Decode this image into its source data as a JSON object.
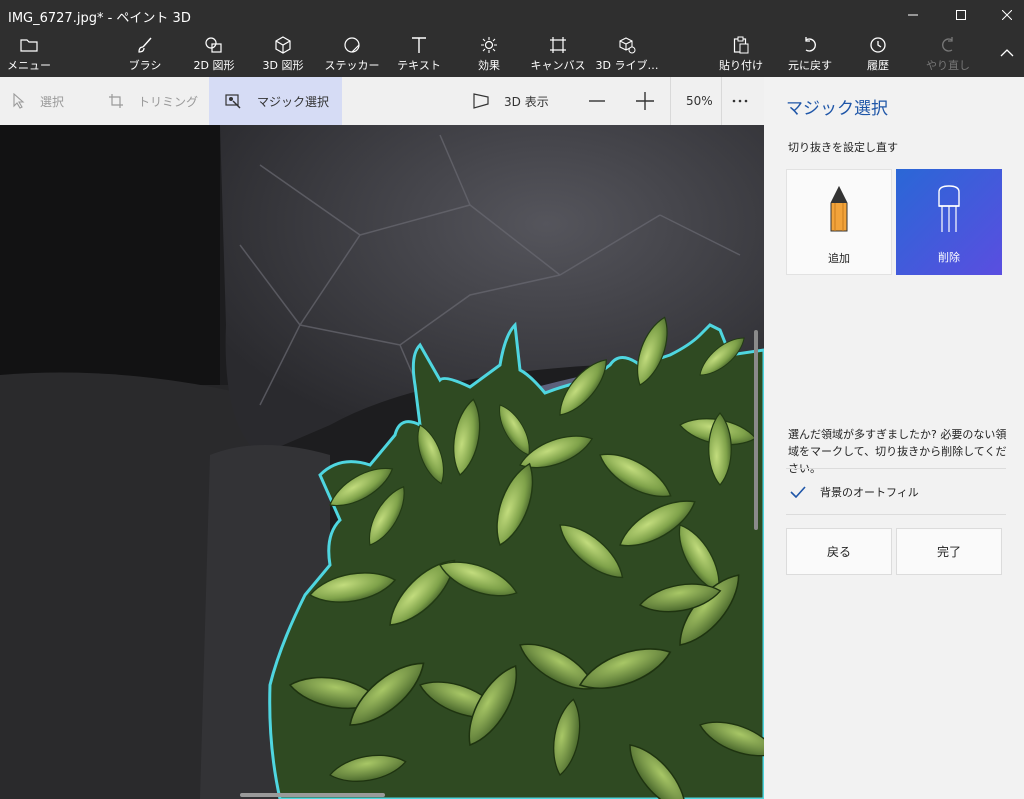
{
  "window": {
    "title": "IMG_6727.jpg* - ペイント 3D",
    "minimize_icon": "minimize-icon",
    "maximize_icon": "maximize-icon",
    "close_icon": "close-icon"
  },
  "ribbon": {
    "menu": "メニュー",
    "brush": "ブラシ",
    "shapes2d": "2D 図形",
    "shapes3d": "3D 図形",
    "stickers": "ステッカー",
    "text": "テキスト",
    "effects": "効果",
    "canvas": "キャンバス",
    "library3d": "3D ライブ…",
    "paste": "貼り付け",
    "undo": "元に戻す",
    "history": "履歴",
    "redo": "やり直し"
  },
  "subbar": {
    "select": "選択",
    "crop": "トリミング",
    "magic_select": "マジック選択",
    "view3d": "3D 表示",
    "zoom": "50%"
  },
  "panel": {
    "title": "マジック選択",
    "subtitle": "切り抜きを設定し直す",
    "add_label": "追加",
    "remove_label": "削除",
    "description": "選んだ領域が多すぎましたか? 必要のない領域をマークして、切り抜きから削除してください。",
    "autofill_label": "背景のオートフィル",
    "autofill_checked": true,
    "back_label": "戻る",
    "done_label": "完了"
  },
  "colors": {
    "accent": "#1f56a8",
    "selection_outline": "#4fd6e0",
    "active_tool_gradient_start": "#2a67d6",
    "active_tool_gradient_end": "#5a4ee0"
  }
}
